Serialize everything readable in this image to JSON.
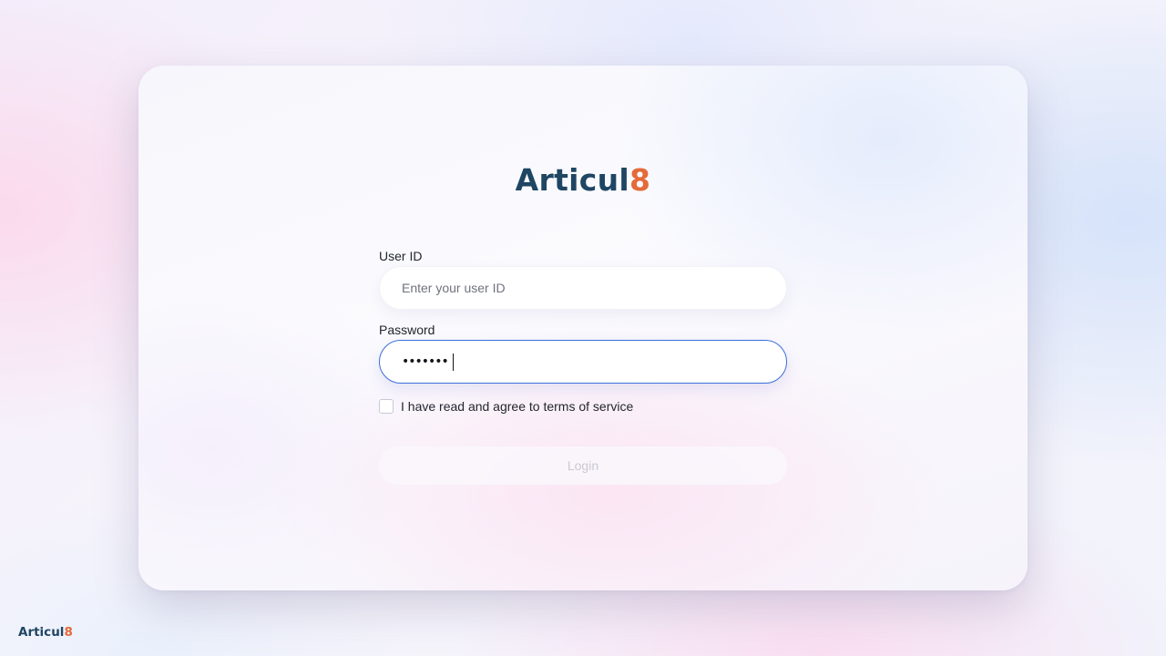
{
  "brand": {
    "wordmark": "Articul",
    "accent_char": "8",
    "colors": {
      "primary": "#1f4663",
      "accent": "#e46a3a"
    }
  },
  "form": {
    "user_id": {
      "label": "User ID",
      "placeholder": "Enter your user ID",
      "value": ""
    },
    "password": {
      "label": "Password",
      "masked_value": "•••••••",
      "focused": true,
      "focus_color": "#3b6fd8"
    },
    "terms": {
      "label": "I have read and agree to terms of service",
      "checked": false
    },
    "login_button": {
      "label": "Login",
      "disabled": true
    }
  },
  "footer": {
    "wordmark": "Articul",
    "accent_char": "8"
  }
}
